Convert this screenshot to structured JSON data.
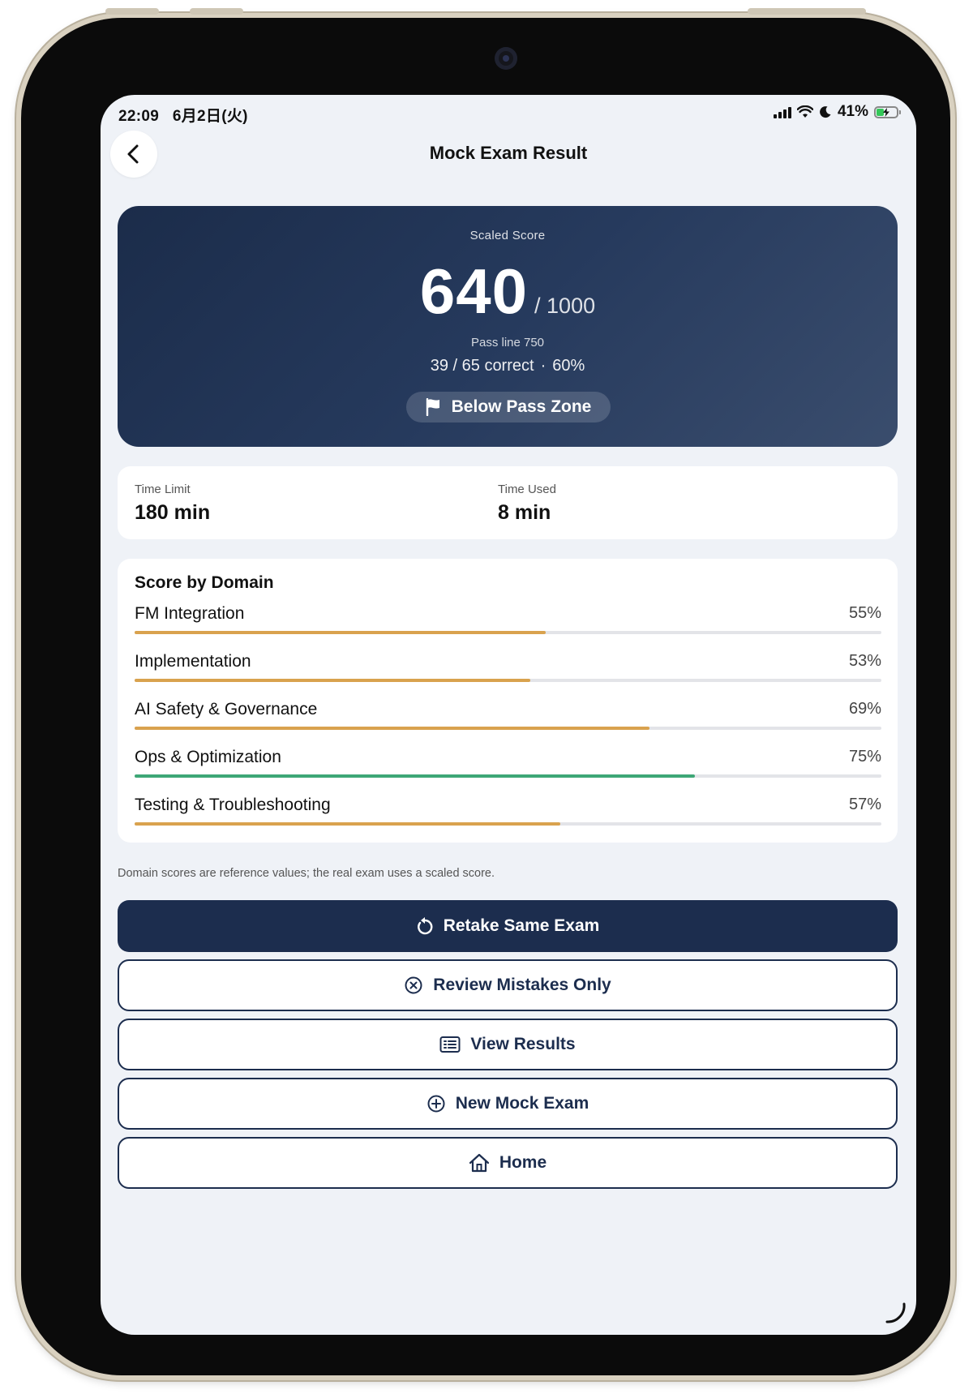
{
  "status_bar": {
    "time": "22:09",
    "date": "6月2日(火)",
    "battery_percent": "41%",
    "battery_level": 0.41
  },
  "nav": {
    "title": "Mock Exam Result",
    "back_icon": "chevron-left-icon"
  },
  "score": {
    "label": "Scaled Score",
    "value": "640",
    "max": "/ 1000",
    "pass_line": "Pass line 750",
    "correct": "39 / 65 correct",
    "separator": "·",
    "percent": "60%",
    "zone_label": "Below Pass Zone",
    "zone_icon": "flag-icon"
  },
  "time": {
    "limit_label": "Time Limit",
    "limit_value": "180 min",
    "used_label": "Time Used",
    "used_value": "8 min"
  },
  "domains": {
    "title": "Score by Domain",
    "items": [
      {
        "name": "FM Integration",
        "percent_label": "55%",
        "value": 0.55,
        "color": "#d9a24e"
      },
      {
        "name": "Implementation",
        "percent_label": "53%",
        "value": 0.53,
        "color": "#d9a24e"
      },
      {
        "name": "AI Safety & Governance",
        "percent_label": "69%",
        "value": 0.69,
        "color": "#d9a24e"
      },
      {
        "name": "Ops & Optimization",
        "percent_label": "75%",
        "value": 0.75,
        "color": "#3ea776"
      },
      {
        "name": "Testing & Troubleshooting",
        "percent_label": "57%",
        "value": 0.57,
        "color": "#d9a24e"
      }
    ]
  },
  "note": "Domain scores are reference values; the real exam uses a scaled score.",
  "actions": {
    "retake": "Retake Same Exam",
    "review": "Review Mistakes Only",
    "view_results": "View Results",
    "new_exam": "New Mock Exam",
    "home": "Home"
  },
  "colors": {
    "primary": "#1c2d4e",
    "warning_bar": "#d9a24e",
    "success_bar": "#3ea776",
    "background": "#eff2f7"
  }
}
